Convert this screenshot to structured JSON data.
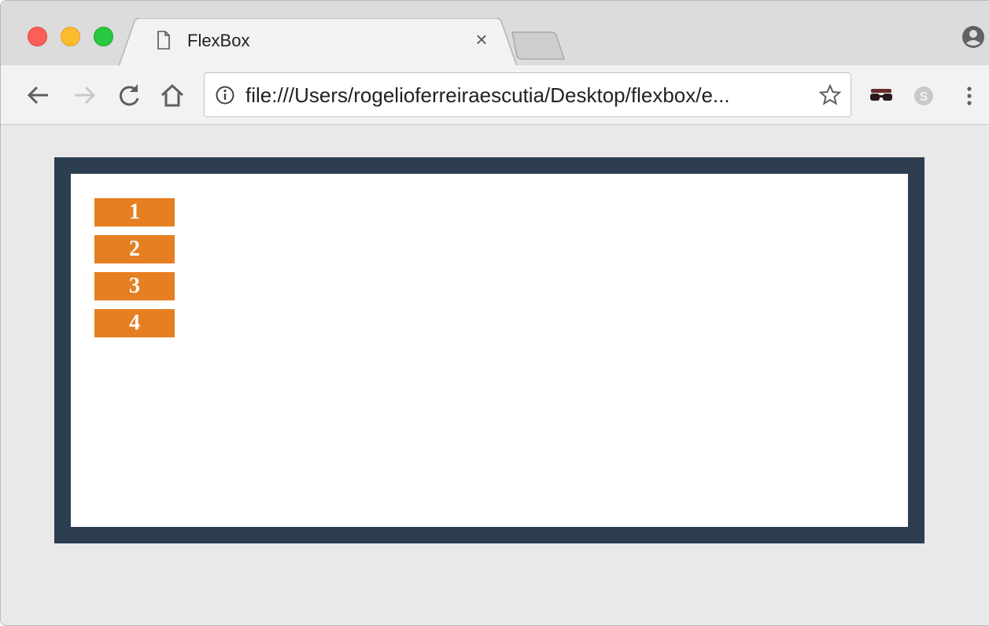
{
  "browser": {
    "tab": {
      "title": "FlexBox",
      "close_glyph": "×"
    },
    "toolbar": {
      "back_icon": "back-arrow-icon",
      "forward_icon": "forward-arrow-icon",
      "reload_icon": "reload-icon",
      "home_icon": "home-icon",
      "url": "file:///Users/rogelioferreiraescutia/Desktop/flexbox/e...",
      "info_icon": "info-icon",
      "bookmark_icon": "star-icon",
      "extensions": [
        "incognito-glasses-icon",
        "skype-icon"
      ],
      "menu_icon": "kebab-menu-icon"
    },
    "profile_icon": "profile-icon"
  },
  "page": {
    "items": [
      "1",
      "2",
      "3",
      "4"
    ]
  },
  "colors": {
    "container_border": "#2c3e50",
    "item_background": "#e67e22",
    "item_text": "#ffffff"
  }
}
